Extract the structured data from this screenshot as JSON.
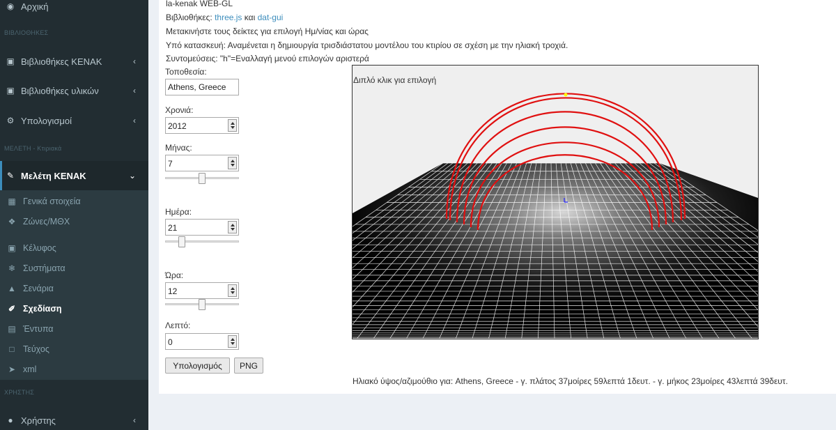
{
  "sidebar": {
    "home": {
      "label": "Αρχική",
      "icon": "dashboard-icon"
    },
    "header_libraries": "ΒΙΒΛΙΟΘΗΚΕΣ",
    "lib_kenak": {
      "label": "Βιβλιοθήκες ΚΕΝΑΚ",
      "icon": "bank-icon"
    },
    "lib_materials": {
      "label": "Βιβλιοθήκες υλικών",
      "icon": "bank-icon"
    },
    "calculations": {
      "label": "Υπολογισμοί",
      "icon": "cogs-icon"
    },
    "header_study": "ΜΕΛΕΤΗ - Κτιριακά",
    "study_kenak": {
      "label": "Μελέτη ΚΕΝΑΚ",
      "icon": "edit-icon"
    },
    "sub_items": [
      {
        "label": "Γενικά στοιχεία",
        "icon": "map-icon"
      },
      {
        "label": "Ζώνες/ΜΘΧ",
        "icon": "cubes-icon"
      },
      {
        "label": "Κέλυφος",
        "icon": "object-group-icon"
      },
      {
        "label": "Συστήματα",
        "icon": "snowflake-icon"
      },
      {
        "label": "Σενάρια",
        "icon": "sitemap-icon"
      },
      {
        "label": "Σχεδίαση",
        "icon": "paint-brush-icon"
      },
      {
        "label": "Έντυπα",
        "icon": "file-excel-icon"
      },
      {
        "label": "Τεύχος",
        "icon": "file-pdf-icon"
      },
      {
        "label": "xml",
        "icon": "send-icon"
      }
    ],
    "header_user": "ΧΡΗΣΤΗΣ",
    "user": {
      "label": "Χρήστης",
      "icon": "user-icon"
    }
  },
  "content": {
    "app_title": "la-kenak WEB-GL",
    "libraries_prefix": "Βιβλιοθήκες:",
    "lib1": "three.js",
    "lib_and": "και",
    "lib2": "dat-gui",
    "instructions": "Μετακινήστε τους δείκτες για επιλογή Ημ/νίας και ώρας",
    "under_construction": "Υπό κατασκευή: Αναμένεται η δημιουργία τρισδιάστατου μοντέλου του κτιρίου σε σχέση με την ηλιακή τροχιά.",
    "shortcuts": "Συντομεύσεις: \"h\"=Εναλλαγή μενού επιλογών αριστερά"
  },
  "form": {
    "location_label": "Τοποθεσία:",
    "location_value": "Athens, Greece",
    "year_label": "Χρονιά:",
    "year_value": "2012",
    "month_label": "Μήνας:",
    "month_value": "7",
    "month_fraction": 0.5,
    "day_label": "Ημέρα:",
    "day_value": "21",
    "day_fraction": 0.2,
    "hour_label": "Ώρα:",
    "hour_value": "12",
    "hour_fraction": 0.5,
    "minute_label": "Λεπτό:",
    "minute_value": "0",
    "calc_button": "Υπολογισμός",
    "png_button": "PNG"
  },
  "viewport": {
    "hint": "Διπλό κλικ για επιλογή",
    "arc_color": "#e01010",
    "sun_color": "#ffff00"
  },
  "status": "Ηλιακό ύψος/αζιμούθιο για: Athens, Greece - γ. πλάτος 37μοίρες 59λεπτά 1δευτ. - γ. μήκος 23μοίρες 43λεπτά 39δευτ."
}
